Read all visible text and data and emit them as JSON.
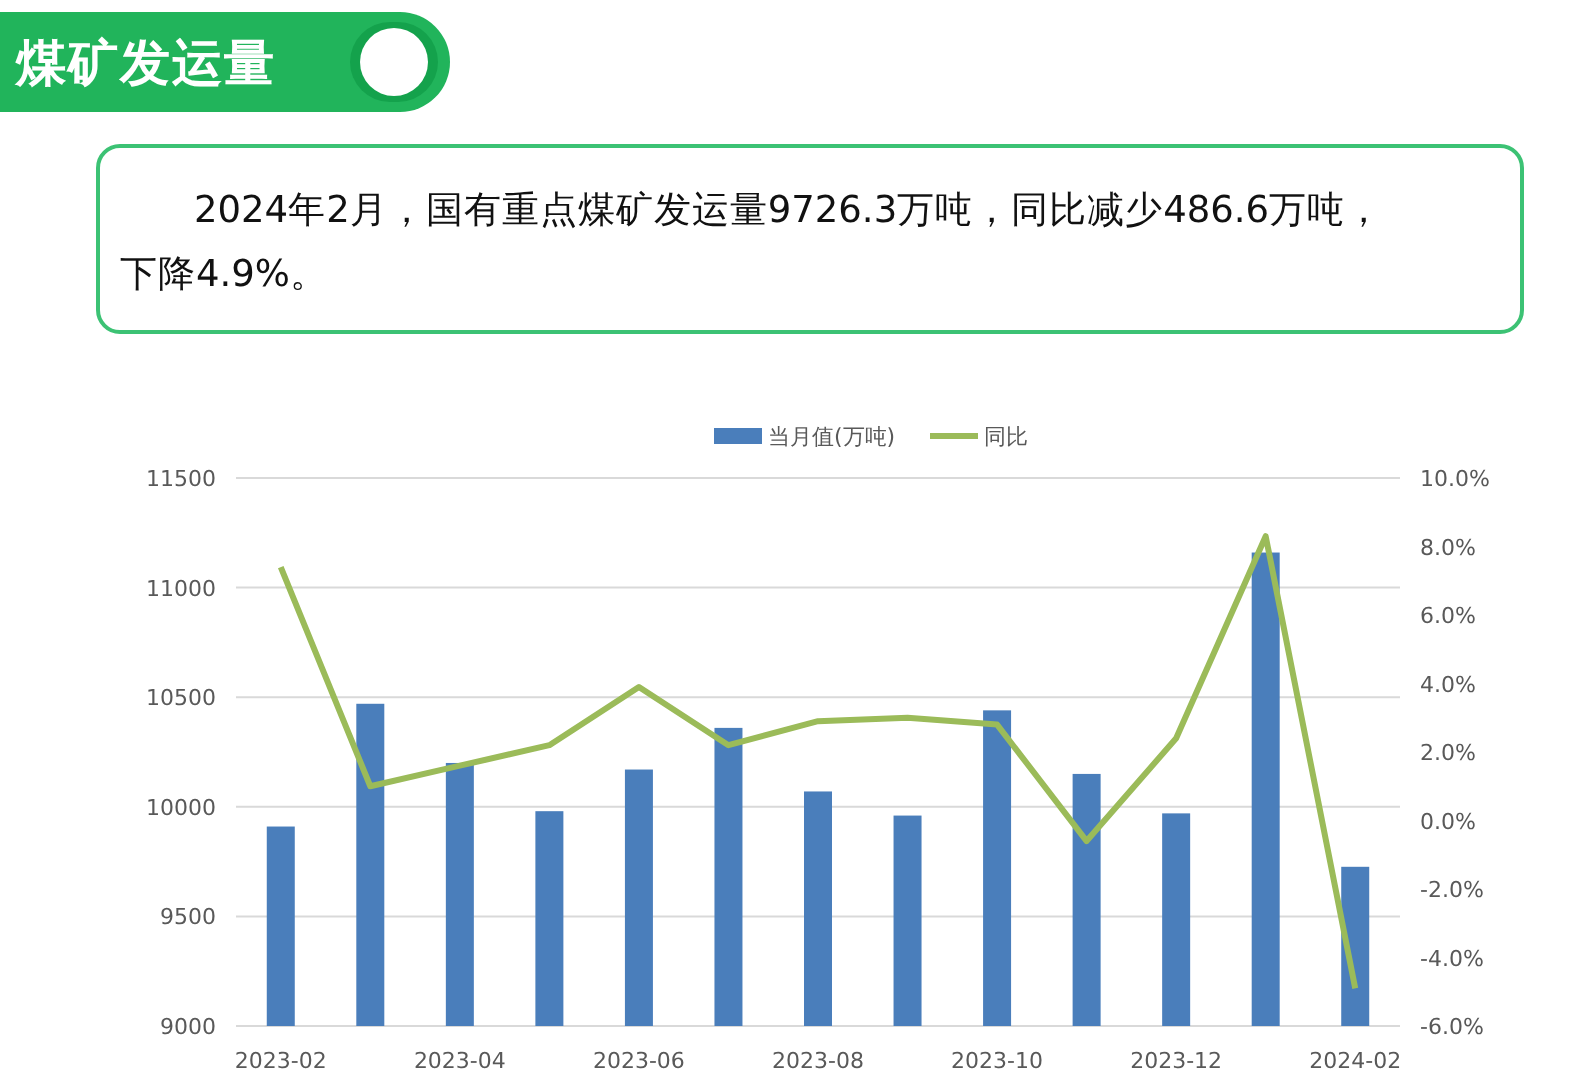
{
  "header": {
    "title": "煤矿发运量"
  },
  "summary": {
    "text": "2024年2月，国有重点煤矿发运量9726.3万吨，同比减少486.6万吨，下降4.9%。"
  },
  "chart": {
    "chart_data": {
      "type": "bar",
      "grid": true,
      "legend": "top",
      "categories": [
        "2023-02",
        null,
        "2023-04",
        null,
        "2023-06",
        null,
        "2023-08",
        null,
        "2023-10",
        null,
        "2023-12",
        null,
        "2024-02"
      ],
      "ylim": [
        9000,
        11500
      ],
      "yticks": [
        9000,
        9500,
        10000,
        10500,
        11000,
        11500
      ],
      "y2lim": [
        -6,
        10
      ],
      "y2ticks": [
        {
          "value": -6,
          "label": "-6.0%"
        },
        {
          "value": -4,
          "label": "-4.0%"
        },
        {
          "value": -2,
          "label": "-2.0%"
        },
        {
          "value": 0,
          "label": "0.0%"
        },
        {
          "value": 2,
          "label": "2.0%"
        },
        {
          "value": 4,
          "label": "4.0%"
        },
        {
          "value": 6,
          "label": "6.0%"
        },
        {
          "value": 8,
          "label": "8.0%"
        },
        {
          "value": 10,
          "label": "10.0%"
        }
      ],
      "series": [
        {
          "name": "当月值(万吨)",
          "type": "bar",
          "color": "#4a7ebb",
          "values": [
            9910,
            10470,
            10200,
            9980,
            10170,
            10360,
            10070,
            9960,
            10440,
            10150,
            9970,
            11160,
            9726.3
          ]
        },
        {
          "name": "同比",
          "type": "line",
          "axis": "y2",
          "color": "#9bbb59",
          "values": [
            7.4,
            1.0,
            1.6,
            2.2,
            3.9,
            2.2,
            2.9,
            3.0,
            2.8,
            -0.6,
            2.4,
            8.3,
            -4.9
          ]
        }
      ]
    }
  }
}
